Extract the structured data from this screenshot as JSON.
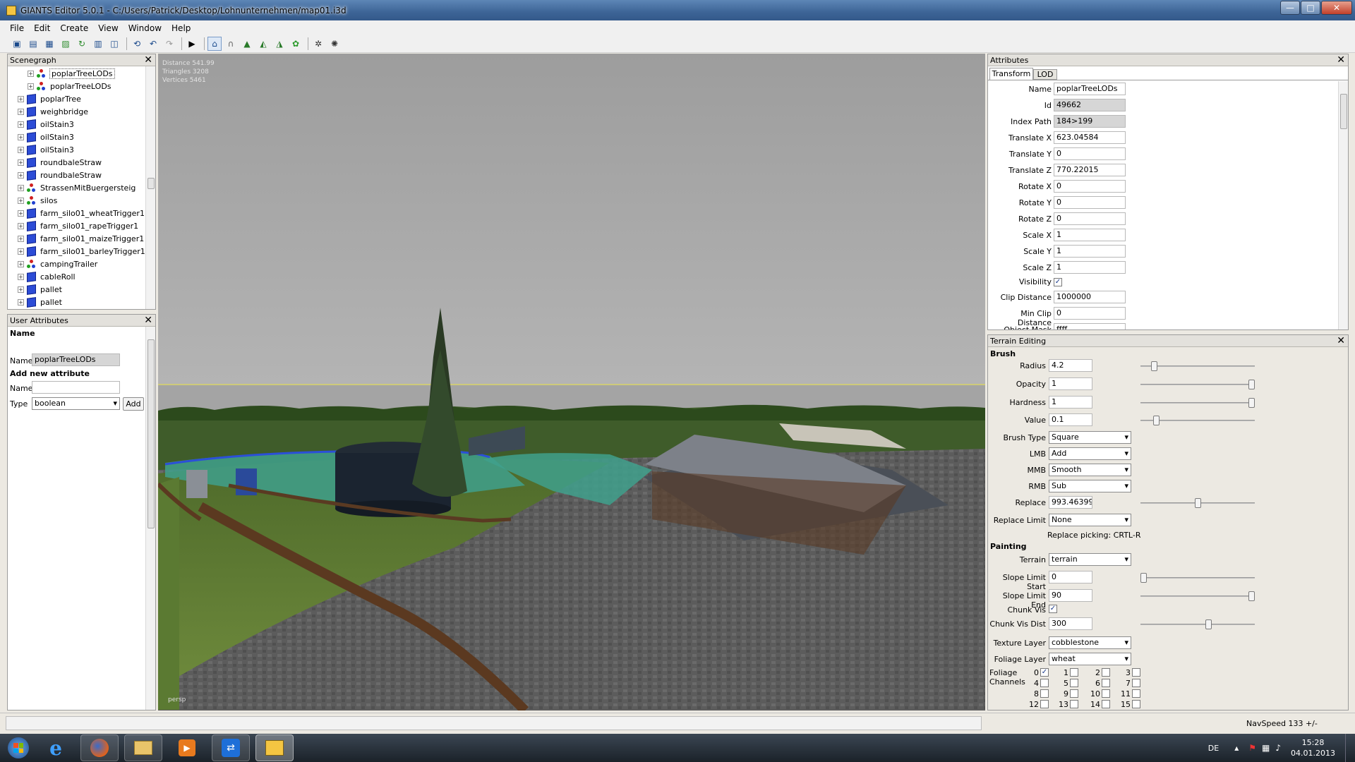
{
  "window": {
    "title": "GIANTS Editor 5.0.1 - C:/Users/Patrick/Desktop/Lohnunternehmen/map01.i3d",
    "minimize": "—",
    "maximize": "□",
    "close": "✕"
  },
  "menu": [
    "File",
    "Edit",
    "Create",
    "View",
    "Window",
    "Help"
  ],
  "toolbar_icons": [
    "new-icon",
    "open-icon",
    "import-icon",
    "export-icon",
    "refresh-icon",
    "save-icon",
    "save-as-icon",
    "reload-icon",
    "undo-icon",
    "redo-icon",
    "play-icon",
    "select-icon",
    "magnet-icon",
    "terrain-raise-icon",
    "terrain-smooth-icon",
    "terrain-paint-icon",
    "foliage-icon",
    "settings-icon",
    "network-icon"
  ],
  "scenegraph": {
    "title": "Scenegraph",
    "items": [
      {
        "label": "poplarTreeLODs",
        "icon": "lod",
        "indent": 2,
        "selected": true
      },
      {
        "label": "poplarTreeLODs",
        "icon": "lod",
        "indent": 2
      },
      {
        "label": "poplarTree",
        "icon": "cube",
        "indent": 1
      },
      {
        "label": "weighbridge",
        "icon": "cube",
        "indent": 1
      },
      {
        "label": "oilStain3",
        "icon": "cube",
        "indent": 1
      },
      {
        "label": "oilStain3",
        "icon": "cube",
        "indent": 1
      },
      {
        "label": "oilStain3",
        "icon": "cube",
        "indent": 1
      },
      {
        "label": "roundbaleStraw",
        "icon": "cube",
        "indent": 1
      },
      {
        "label": "roundbaleStraw",
        "icon": "cube",
        "indent": 1
      },
      {
        "label": "StrassenMitBuergersteig",
        "icon": "lod",
        "indent": 1
      },
      {
        "label": "silos",
        "icon": "lod",
        "indent": 1
      },
      {
        "label": "farm_silo01_wheatTrigger1",
        "icon": "cube",
        "indent": 1
      },
      {
        "label": "farm_silo01_rapeTrigger1",
        "icon": "cube",
        "indent": 1
      },
      {
        "label": "farm_silo01_maizeTrigger1",
        "icon": "cube",
        "indent": 1
      },
      {
        "label": "farm_silo01_barleyTrigger1",
        "icon": "cube",
        "indent": 1
      },
      {
        "label": "campingTrailer",
        "icon": "lod",
        "indent": 1
      },
      {
        "label": "cableRoll",
        "icon": "cube",
        "indent": 1
      },
      {
        "label": "pallet",
        "icon": "cube",
        "indent": 1
      },
      {
        "label": "pallet",
        "icon": "cube",
        "indent": 1
      }
    ]
  },
  "user_attributes": {
    "title": "User Attributes",
    "name_heading": "Name",
    "name_label": "Name",
    "name_value": "poplarTreeLODs",
    "add_heading": "Add new attribute",
    "new_name_label": "Name",
    "new_name_value": "",
    "type_label": "Type",
    "type_value": "boolean",
    "add_button": "Add"
  },
  "viewport": {
    "stats": [
      "Distance 541.99",
      "Triangles 3208",
      "Vertices 5461"
    ],
    "camera": "persp"
  },
  "attributes": {
    "title": "Attributes",
    "tabs": [
      "Transform",
      "LOD"
    ],
    "rows": [
      {
        "label": "Name",
        "value": "poplarTreeLODs"
      },
      {
        "label": "Id",
        "value": "49662",
        "readonly": true
      },
      {
        "label": "Index Path",
        "value": "184>199",
        "readonly": true
      },
      {
        "label": "Translate X",
        "value": "623.04584"
      },
      {
        "label": "Translate Y",
        "value": "0"
      },
      {
        "label": "Translate Z",
        "value": "770.22015"
      },
      {
        "label": "Rotate X",
        "value": "0"
      },
      {
        "label": "Rotate Y",
        "value": "0"
      },
      {
        "label": "Rotate Z",
        "value": "0"
      },
      {
        "label": "Scale X",
        "value": "1"
      },
      {
        "label": "Scale Y",
        "value": "1"
      },
      {
        "label": "Scale Z",
        "value": "1"
      }
    ],
    "visibility_label": "Visibility",
    "visibility_checked": true,
    "rows2": [
      {
        "label": "Clip Distance",
        "value": "1000000"
      },
      {
        "label": "Min Clip Distance",
        "value": "0"
      },
      {
        "label": "Object Mask",
        "value": "ffff"
      }
    ]
  },
  "terrain": {
    "title": "Terrain Editing",
    "brush_heading": "Brush",
    "radius": {
      "label": "Radius",
      "value": "4.2",
      "level": 0.1
    },
    "opacity": {
      "label": "Opacity",
      "value": "1",
      "level": 1.0
    },
    "hardness": {
      "label": "Hardness",
      "value": "1",
      "level": 1.0
    },
    "value": {
      "label": "Value",
      "value": "0.1",
      "level": 0.12
    },
    "brush_type": {
      "label": "Brush Type",
      "value": "Square"
    },
    "lmb": {
      "label": "LMB",
      "value": "Add"
    },
    "mmb": {
      "label": "MMB",
      "value": "Smooth"
    },
    "rmb": {
      "label": "RMB",
      "value": "Sub"
    },
    "replace": {
      "label": "Replace",
      "value": "993.46399",
      "level": 0.5
    },
    "replace_limit": {
      "label": "Replace Limit",
      "value": "None"
    },
    "replace_hint": "Replace picking: CRTL-R",
    "painting_heading": "Painting",
    "terrain_sel": {
      "label": "Terrain",
      "value": "terrain"
    },
    "slope_start": {
      "label": "Slope Limit Start",
      "value": "0",
      "level": 0.0
    },
    "slope_end": {
      "label": "Slope Limit End",
      "value": "90",
      "level": 1.0
    },
    "chunk_vis": {
      "label": "Chunk Vis",
      "checked": true
    },
    "chunk_vis_dist": {
      "label": "Chunk Vis Dist",
      "value": "300",
      "level": 0.6
    },
    "texture_layer": {
      "label": "Texture Layer",
      "value": "cobblestone"
    },
    "foliage_layer": {
      "label": "Foliage Layer",
      "value": "wheat"
    },
    "foliage_channels_label": "Foliage Channels",
    "channels": [
      {
        "n": "0",
        "checked": true
      },
      {
        "n": "1"
      },
      {
        "n": "2"
      },
      {
        "n": "3"
      },
      {
        "n": "4"
      },
      {
        "n": "5"
      },
      {
        "n": "6"
      },
      {
        "n": "7"
      },
      {
        "n": "8"
      },
      {
        "n": "9"
      },
      {
        "n": "10"
      },
      {
        "n": "11"
      },
      {
        "n": "12"
      },
      {
        "n": "13"
      },
      {
        "n": "14"
      },
      {
        "n": "15"
      }
    ]
  },
  "statusbar": {
    "navspeed": "NavSpeed 133 +/-"
  },
  "taskbar": {
    "apps": [
      "windows-start-icon",
      "internet-explorer-icon",
      "firefox-icon",
      "file-explorer-icon",
      "media-player-icon",
      "teamviewer-icon",
      "giants-editor-icon"
    ],
    "lang": "DE",
    "time": "15:28",
    "date": "04.01.2013"
  }
}
